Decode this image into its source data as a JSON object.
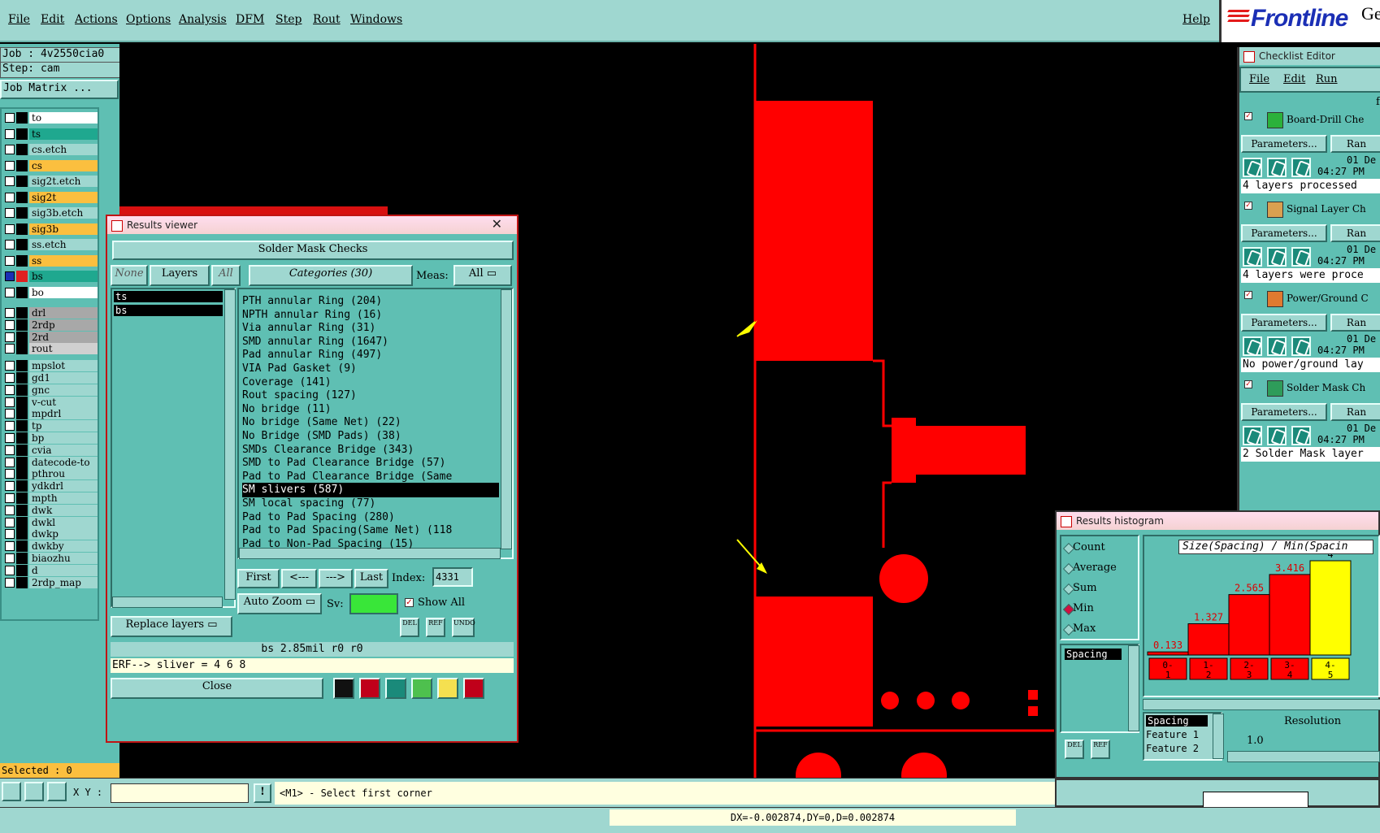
{
  "menu": {
    "items": [
      "File",
      "Edit",
      "Actions",
      "Options",
      "Analysis",
      "DFM",
      "Step",
      "Rout",
      "Windows"
    ],
    "help": "Help",
    "logo": "Frontline",
    "logo_extra": "Ge"
  },
  "job": {
    "job_line": "Job : 4v2550cia0",
    "step_line": "Step: cam",
    "matrix_button": "Job Matrix ..."
  },
  "layers": [
    {
      "name": "to",
      "color": "#ffffff"
    },
    {
      "name": "ts",
      "color": "#1fa88f"
    },
    {
      "name": "cs.etch",
      "color": "#9fd7d0"
    },
    {
      "name": "cs",
      "color": "#fbbf3f"
    },
    {
      "name": "sig2t.etch",
      "color": "#9fd7d0"
    },
    {
      "name": "sig2t",
      "color": "#fbbf3f"
    },
    {
      "name": "sig3b.etch",
      "color": "#9fd7d0"
    },
    {
      "name": "sig3b",
      "color": "#fbbf3f"
    },
    {
      "name": "ss.etch",
      "color": "#9fd7d0"
    },
    {
      "name": "ss",
      "color": "#fbbf3f"
    },
    {
      "name": "bs",
      "color": "#1fa88f"
    },
    {
      "name": "bo",
      "color": "#ffffff"
    },
    {
      "name": "drl",
      "color": "#a8a8a8"
    },
    {
      "name": "2rdp",
      "color": "#a8a8a8"
    },
    {
      "name": "2rd",
      "color": "#a8a8a8"
    },
    {
      "name": "rout",
      "color": "#d0d0d0"
    },
    {
      "name": "mpslot",
      "color": "#9fd7d0"
    },
    {
      "name": "gd1",
      "color": "#9fd7d0"
    },
    {
      "name": "gnc",
      "color": "#9fd7d0"
    },
    {
      "name": "v-cut",
      "color": "#9fd7d0"
    },
    {
      "name": "mpdrl",
      "color": "#9fd7d0"
    },
    {
      "name": "tp",
      "color": "#9fd7d0"
    },
    {
      "name": "bp",
      "color": "#9fd7d0"
    },
    {
      "name": "cvia",
      "color": "#9fd7d0"
    },
    {
      "name": "datecode-to",
      "color": "#9fd7d0"
    },
    {
      "name": "pthrou",
      "color": "#9fd7d0"
    },
    {
      "name": "ydkdrl",
      "color": "#9fd7d0"
    },
    {
      "name": "mpth",
      "color": "#9fd7d0"
    },
    {
      "name": "dwk",
      "color": "#9fd7d0"
    },
    {
      "name": "dwkl",
      "color": "#9fd7d0"
    },
    {
      "name": "dwkp",
      "color": "#9fd7d0"
    },
    {
      "name": "dwkby",
      "color": "#9fd7d0"
    },
    {
      "name": "biaozhu",
      "color": "#9fd7d0"
    },
    {
      "name": "d",
      "color": "#9fd7d0"
    },
    {
      "name": "2rdp_map",
      "color": "#9fd7d0"
    }
  ],
  "selected": "Selected : 0",
  "results_viewer": {
    "title": "Results viewer",
    "header": "Solder Mask Checks",
    "none_btn": "None",
    "layers_btn": "Layers",
    "all_btn": "All",
    "categories_btn": "Categories (30)",
    "meas_label": "Meas:",
    "meas_value": "All",
    "layer_items": [
      "ts",
      "bs"
    ],
    "categories": [
      "PTH annular Ring (204)",
      "NPTH annular Ring (16)",
      "Via annular Ring (31)",
      "SMD annular Ring (1647)",
      "Pad annular Ring (497)",
      "VIA Pad Gasket (9)",
      "Coverage (141)",
      "Rout spacing (127)",
      "No bridge (11)",
      "No bridge (Same Net) (22)",
      "No Bridge (SMD Pads) (38)",
      "SMDs Clearance Bridge (343)",
      "SMD to Pad Clearance Bridge (57)",
      "Pad to Pad Clearance Bridge (Same",
      "SM slivers (587)",
      "SM local spacing (77)",
      "Pad to Pad Spacing (280)",
      "Pad to Pad Spacing(Same Net) (118",
      "Pad to Non-Pad Spacing (15)"
    ],
    "selected_category": "SM slivers (587)",
    "first": "First",
    "prev": "<---",
    "next": "--->",
    "last": "Last",
    "index_label": "Index:",
    "index_value": "4331",
    "auto_zoom": "Auto Zoom",
    "sv_label": "Sv:",
    "show_all": "Show All",
    "replace_layers": "Replace layers",
    "del": "DEL",
    "ref": "REF",
    "undo": "UNDO",
    "info_line": "bs 2.85mil  r0  r0",
    "erf_line": "ERF--> sliver = 4 6 8",
    "close": "Close"
  },
  "checklist": {
    "title": "Checklist Editor",
    "menu": [
      "File",
      "Edit",
      "Run"
    ],
    "corner": "f",
    "checks": [
      {
        "name": "Board-Drill Che",
        "params": "Parameters...",
        "ran": "Ran",
        "date": "01 De",
        "time": "04:27 PM",
        "status": "4 layers processed",
        "icon_color": "#2bb13b"
      },
      {
        "name": "Signal Layer Ch",
        "params": "Parameters...",
        "ran": "Ran",
        "date": "01 De",
        "time": "04:27 PM",
        "status": "4 layers were proce",
        "icon_color": "#d9a050"
      },
      {
        "name": "Power/Ground C",
        "params": "Parameters...",
        "ran": "Ran",
        "date": "01 De",
        "time": "04:27 PM",
        "status": "No power/ground lay",
        "icon_color": "#e07a30"
      },
      {
        "name": "Solder Mask Ch",
        "params": "Parameters...",
        "ran": "Ran",
        "date": "01 De",
        "time": "04:27 PM",
        "status": "2 Solder Mask layer",
        "icon_color": "#2e9c5a"
      }
    ]
  },
  "histogram": {
    "title": "Results histogram",
    "modes": [
      "Count",
      "Average",
      "Sum",
      "Min",
      "Max"
    ],
    "selected_mode": "Min",
    "list_item": "Spacing",
    "chart_title": "Size(Spacing) / Min(Spacin",
    "resolution_label": "Resolution",
    "resolution_value": "1.0",
    "features": [
      "Spacing",
      "Feature 1",
      "Feature 2"
    ],
    "del": "DEL",
    "ref": "REF"
  },
  "chart_data": {
    "type": "bar",
    "title": "Size(Spacing) / Min(Spacin",
    "categories": [
      "0-1",
      "1-2",
      "2-3",
      "3-4",
      "4-5"
    ],
    "values": [
      0.133,
      1.327,
      2.565,
      3.416,
      4
    ],
    "value_labels": [
      "0.133",
      "1.327",
      "2.565",
      "3.416",
      "4"
    ],
    "colors": [
      "#ff0000",
      "#ff0000",
      "#ff0000",
      "#ff0000",
      "#ffff00"
    ],
    "ylim": [
      0,
      4
    ]
  },
  "cmdbar": {
    "xy_label": "X Y :",
    "xy_value": "",
    "prompt": "<M1> - Select first corner"
  },
  "bottombar": {
    "measure": "DX=-0.002874,DY=0,D=0.002874"
  }
}
